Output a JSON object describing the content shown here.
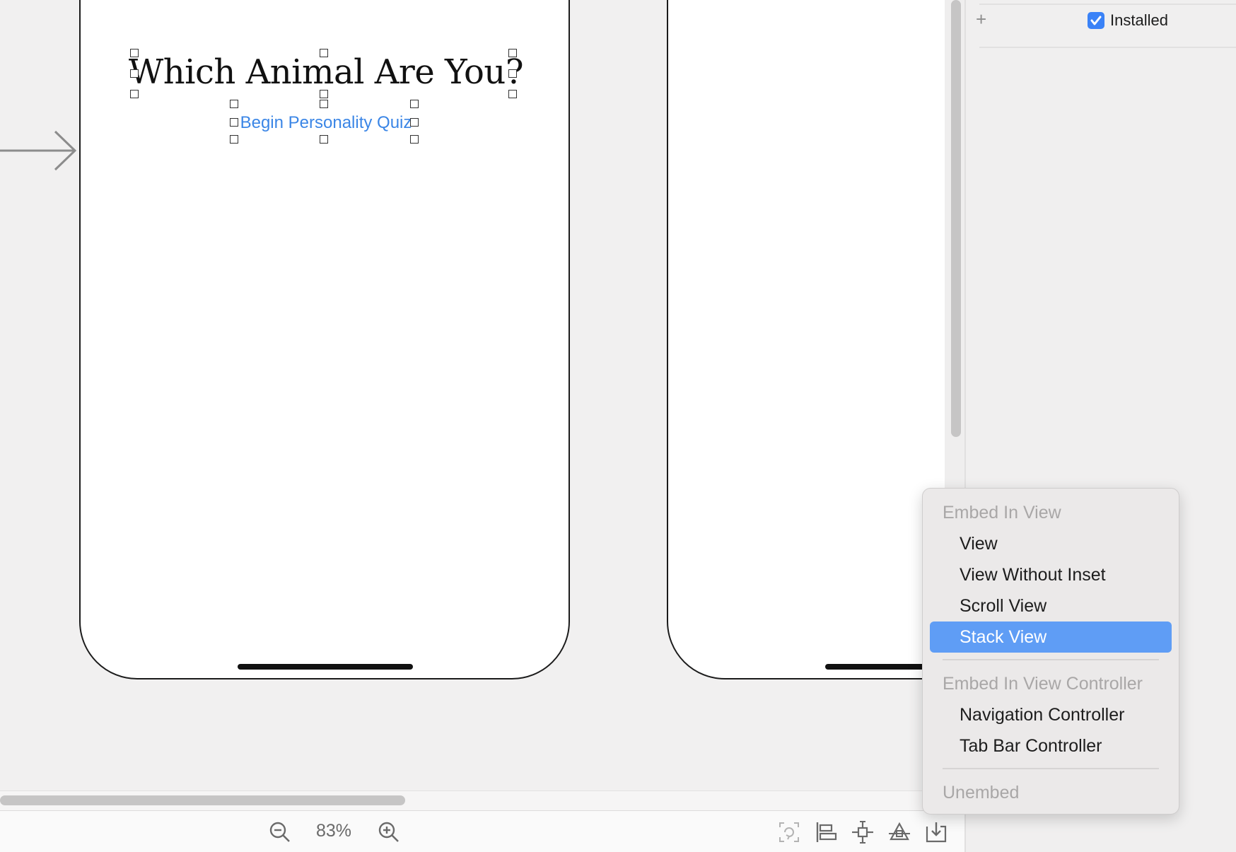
{
  "canvas": {
    "scene_title": "Which Animal Are You?",
    "scene_button_title": "Begin Personality Quiz"
  },
  "bottom_bar": {
    "zoom_level": "83%",
    "icons": [
      "zoom-out-icon",
      "zoom-in-icon",
      "update-frames-icon",
      "align-icon",
      "add-constraints-icon",
      "resolve-issues-icon",
      "embed-in-icon"
    ]
  },
  "inspector": {
    "installed_label": "Installed",
    "installed_checked": true
  },
  "embed_menu": {
    "header_view": "Embed In View",
    "items_view": [
      "View",
      "View Without Inset",
      "Scroll View",
      "Stack View"
    ],
    "selected": "Stack View",
    "header_controller": "Embed In View Controller",
    "items_controller": [
      "Navigation Controller",
      "Tab Bar Controller"
    ],
    "unembed": "Unembed"
  },
  "colors": {
    "accent": "#3a82f7",
    "menu_selection": "#5f9df5",
    "button_text": "#3b86e6"
  }
}
